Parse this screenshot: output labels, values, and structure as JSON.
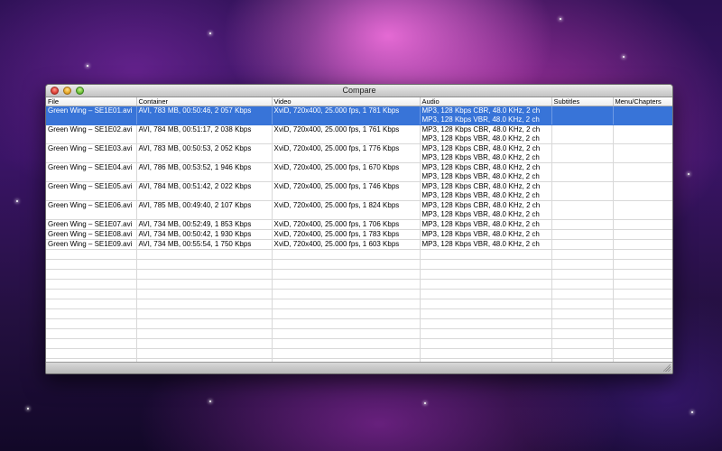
{
  "window": {
    "title": "Compare"
  },
  "table": {
    "columns": [
      "File",
      "Container",
      "Video",
      "Audio",
      "Subtitles",
      "Menu/Chapters"
    ],
    "rows": [
      {
        "file": "Green Wing – SE1E01.avi",
        "container": "AVI, 783 MB, 00:50:46, 2 057 Kbps",
        "video": "XviD, 720x400, 25.000 fps, 1 781 Kbps",
        "audio": [
          "MP3, 128 Kbps CBR, 48.0 KHz, 2 ch",
          "MP3, 128 Kbps VBR, 48.0 KHz, 2 ch"
        ],
        "subtitles": "",
        "menu_chapters": ""
      },
      {
        "file": "Green Wing – SE1E02.avi",
        "container": "AVI, 784 MB, 00:51:17, 2 038 Kbps",
        "video": "XviD, 720x400, 25.000 fps, 1 761 Kbps",
        "audio": [
          "MP3, 128 Kbps CBR, 48.0 KHz, 2 ch",
          "MP3, 128 Kbps VBR, 48.0 KHz, 2 ch"
        ],
        "subtitles": "",
        "menu_chapters": ""
      },
      {
        "file": "Green Wing – SE1E03.avi",
        "container": "AVI, 783 MB, 00:50:53, 2 052 Kbps",
        "video": "XviD, 720x400, 25.000 fps, 1 776 Kbps",
        "audio": [
          "MP3, 128 Kbps CBR, 48.0 KHz, 2 ch",
          "MP3, 128 Kbps VBR, 48.0 KHz, 2 ch"
        ],
        "subtitles": "",
        "menu_chapters": ""
      },
      {
        "file": "Green Wing – SE1E04.avi",
        "container": "AVI, 786 MB, 00:53:52, 1 946 Kbps",
        "video": "XviD, 720x400, 25.000 fps, 1 670 Kbps",
        "audio": [
          "MP3, 128 Kbps CBR, 48.0 KHz, 2 ch",
          "MP3, 128 Kbps VBR, 48.0 KHz, 2 ch"
        ],
        "subtitles": "",
        "menu_chapters": ""
      },
      {
        "file": "Green Wing – SE1E05.avi",
        "container": "AVI, 784 MB, 00:51:42, 2 022 Kbps",
        "video": "XviD, 720x400, 25.000 fps, 1 746 Kbps",
        "audio": [
          "MP3, 128 Kbps CBR, 48.0 KHz, 2 ch",
          "MP3, 128 Kbps VBR, 48.0 KHz, 2 ch"
        ],
        "subtitles": "",
        "menu_chapters": ""
      },
      {
        "file": "Green Wing – SE1E06.avi",
        "container": "AVI, 785 MB, 00:49:40, 2 107 Kbps",
        "video": "XviD, 720x400, 25.000 fps, 1 824 Kbps",
        "audio": [
          "MP3, 128 Kbps CBR, 48.0 KHz, 2 ch",
          "MP3, 128 Kbps VBR, 48.0 KHz, 2 ch"
        ],
        "subtitles": "",
        "menu_chapters": ""
      },
      {
        "file": "Green Wing – SE1E07.avi",
        "container": "AVI, 734 MB, 00:52:49, 1 853 Kbps",
        "video": "XviD, 720x400, 25.000 fps, 1 706 Kbps",
        "audio": [
          "MP3, 128 Kbps VBR, 48.0 KHz, 2 ch"
        ],
        "subtitles": "",
        "menu_chapters": ""
      },
      {
        "file": "Green Wing – SE1E08.avi",
        "container": "AVI, 734 MB, 00:50:42, 1 930 Kbps",
        "video": "XviD, 720x400, 25.000 fps, 1 783 Kbps",
        "audio": [
          "MP3, 128 Kbps VBR, 48.0 KHz, 2 ch"
        ],
        "subtitles": "",
        "menu_chapters": ""
      },
      {
        "file": "Green Wing – SE1E09.avi",
        "container": "AVI, 734 MB, 00:55:54, 1 750 Kbps",
        "video": "XviD, 720x400, 25.000 fps, 1 603 Kbps",
        "audio": [
          "MP3, 128 Kbps VBR, 48.0 KHz, 2 ch"
        ],
        "subtitles": "",
        "menu_chapters": ""
      }
    ],
    "selected_row": 0
  },
  "icons": {
    "close": "close-icon",
    "minimize": "minimize-icon",
    "zoom": "zoom-icon",
    "resize": "resize-grip-icon"
  },
  "colors": {
    "selection": "#3874d8",
    "close": "#e0443a",
    "minimize": "#e8a92a",
    "zoom": "#6fc13a"
  }
}
